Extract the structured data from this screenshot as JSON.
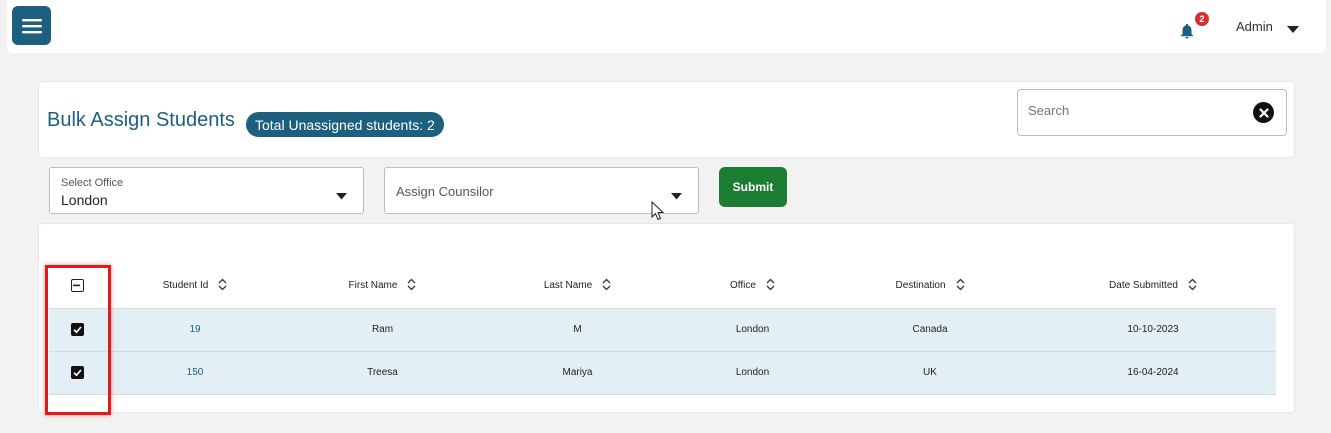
{
  "topbar": {
    "menu_icon": "hamburger-icon",
    "notification_icon": "bell-icon",
    "notification_count": "2",
    "user_name": "Admin",
    "user_caret_icon": "caret-down-icon"
  },
  "header": {
    "title": "Bulk Assign Students",
    "total_label": "Total Unassigned students: 2",
    "search_placeholder": "Search",
    "search_clear_icon": "close-circle-icon"
  },
  "filters": {
    "office": {
      "label": "Select Office",
      "value": "London"
    },
    "counsilor": {
      "placeholder": "Assign Counsilor"
    },
    "submit_label": "Submit"
  },
  "table": {
    "columns": [
      "Student Id",
      "First Name",
      "Last Name",
      "Office",
      "Destination",
      "Date Submitted"
    ],
    "rows": [
      {
        "checked": true,
        "student_id": "19",
        "first_name": "Ram",
        "last_name": "M",
        "office": "London",
        "destination": "Canada",
        "date_submitted": "10-10-2023"
      },
      {
        "checked": true,
        "student_id": "150",
        "first_name": "Treesa",
        "last_name": "Mariya",
        "office": "London",
        "destination": "UK",
        "date_submitted": "16-04-2024"
      }
    ]
  },
  "colors": {
    "primary": "#1d5f7e",
    "submit": "#1a7d32",
    "badge": "#d32f2f",
    "row_bg": "#e4eff5",
    "highlight": "#e01b1b"
  }
}
